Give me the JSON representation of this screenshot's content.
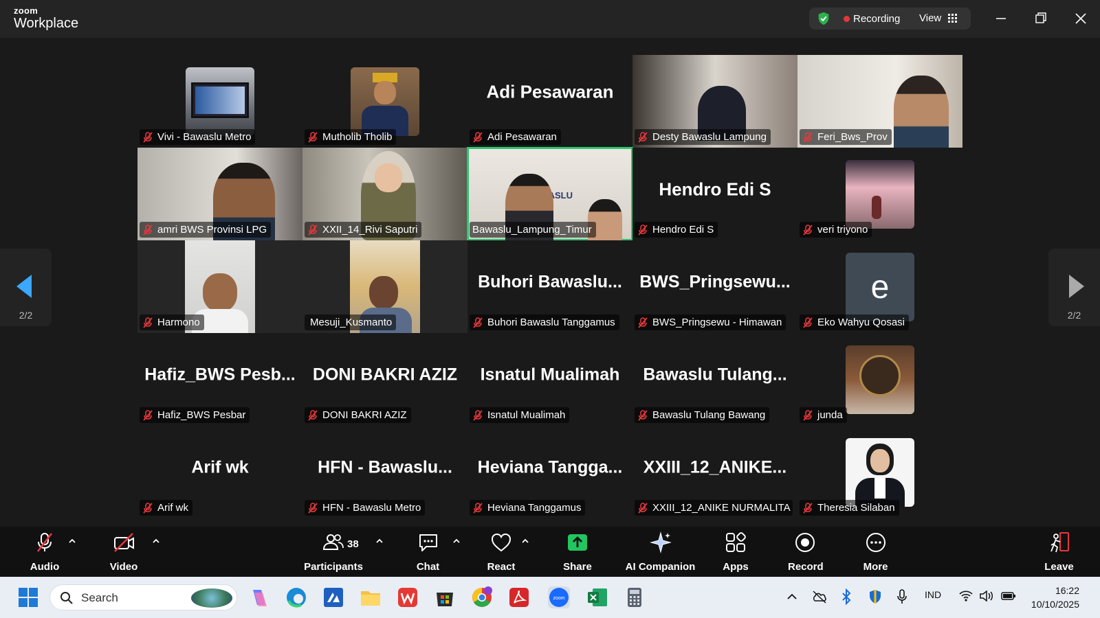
{
  "app": {
    "brand_small": "zoom",
    "brand_large": "Workplace"
  },
  "header": {
    "recording_label": "Recording",
    "view_label": "View"
  },
  "pager": {
    "left_page": "2/2",
    "right_page": "2/2"
  },
  "participants": [
    {
      "name": "Vivi - Bawaslu Metro",
      "display": "",
      "muted": true
    },
    {
      "name": "Mutholib Tholib",
      "display": "",
      "muted": true
    },
    {
      "name": "Adi Pesawaran",
      "display": "Adi Pesawaran",
      "muted": true
    },
    {
      "name": "Desty Bawaslu Lampung",
      "display": "",
      "muted": true
    },
    {
      "name": "Feri_Bws_Prov",
      "display": "",
      "muted": true
    },
    {
      "name": "amri BWS Provinsi LPG",
      "display": "",
      "muted": true
    },
    {
      "name": "XXII_14_Rivi Saputri",
      "display": "",
      "muted": true
    },
    {
      "name": "Bawaslu_Lampung_Timur",
      "display": "",
      "muted": false
    },
    {
      "name": "Hendro Edi S",
      "display": "Hendro Edi S",
      "muted": true
    },
    {
      "name": "veri triyono",
      "display": "",
      "muted": true
    },
    {
      "name": "Harmono",
      "display": "",
      "muted": true
    },
    {
      "name": "Mesuji_Kusmanto",
      "display": "",
      "muted": false
    },
    {
      "name": "Buhori Bawaslu Tanggamus",
      "display": "Buhori  Bawaslu...",
      "muted": true
    },
    {
      "name": "BWS_Pringsewu - Himawan",
      "display": "BWS_Pringsewu...",
      "muted": true
    },
    {
      "name": "Eko Wahyu Qosasi",
      "display": "",
      "initial": "e",
      "muted": true
    },
    {
      "name": "Hafiz_BWS Pesbar",
      "display": "Hafiz_BWS  Pesb...",
      "muted": true
    },
    {
      "name": "DONI BAKRI AZIZ",
      "display": "DONI BAKRI AZIZ",
      "muted": true
    },
    {
      "name": "Isnatul Mualimah",
      "display": "Isnatul Mualimah",
      "muted": true
    },
    {
      "name": "Bawaslu Tulang Bawang",
      "display": "Bawaslu  Tulang...",
      "muted": true
    },
    {
      "name": "junda",
      "display": "",
      "muted": true
    },
    {
      "name": "Arif wk",
      "display": "Arif wk",
      "muted": true
    },
    {
      "name": "HFN - Bawaslu Metro",
      "display": "HFN  -  Bawaslu...",
      "muted": true
    },
    {
      "name": "Heviana Tanggamus",
      "display": "Heviana  Tangga...",
      "muted": true
    },
    {
      "name": "XXIII_12_ANIKE NURMALITA ...",
      "display": "XXIII_12_ANIKE...",
      "muted": true
    },
    {
      "name": "Theresia Silaban",
      "display": "",
      "muted": true
    }
  ],
  "toolbar": {
    "audio": "Audio",
    "video": "Video",
    "participants": "Participants",
    "participants_count": "38",
    "chat": "Chat",
    "react": "React",
    "share": "Share",
    "ai_companion": "AI Companion",
    "apps": "Apps",
    "record": "Record",
    "more": "More",
    "leave": "Leave"
  },
  "taskbar": {
    "search_placeholder": "Search",
    "language": "IND",
    "time": "16:22",
    "date": "10/10/2025"
  },
  "colors": {
    "active_speaker": "#2cc56f",
    "recording_dot": "#e5383b",
    "share_green": "#22c55e",
    "leave_red": "#e5383b"
  }
}
